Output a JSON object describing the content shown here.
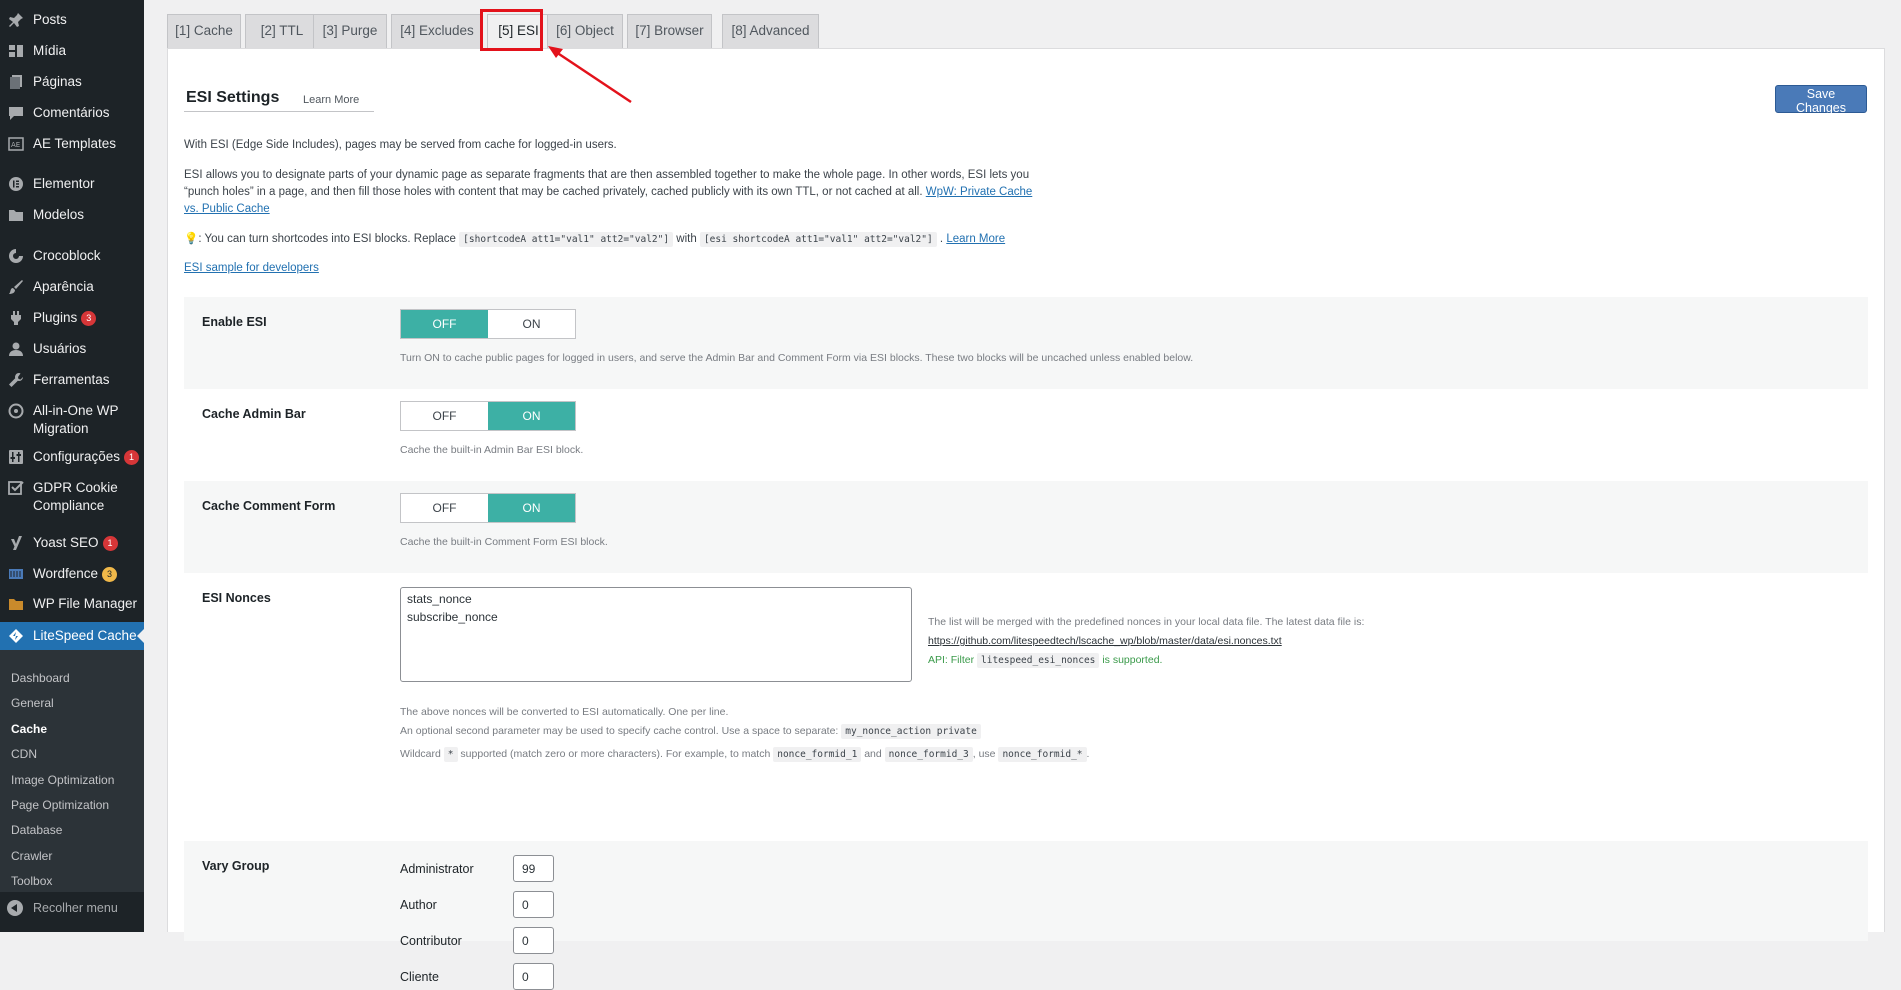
{
  "sidebar": {
    "items": [
      {
        "label": "Posts",
        "icon": "pin-icon"
      },
      {
        "label": "Mídia",
        "icon": "media-icon"
      },
      {
        "label": "Páginas",
        "icon": "pages-icon"
      },
      {
        "label": "Comentários",
        "icon": "comment-icon"
      },
      {
        "label": "AE Templates",
        "icon": "ae-templates-icon"
      },
      {
        "label": "Elementor",
        "icon": "elementor-icon"
      },
      {
        "label": "Modelos",
        "icon": "folder-icon"
      },
      {
        "label": "Crocoblock",
        "icon": "crocoblock-icon"
      },
      {
        "label": "Aparência",
        "icon": "brush-icon"
      },
      {
        "label": "Plugins",
        "icon": "plugin-icon",
        "badge": "3"
      },
      {
        "label": "Usuários",
        "icon": "user-icon"
      },
      {
        "label": "Ferramentas",
        "icon": "wrench-icon"
      },
      {
        "label": "All-in-One WP Migration",
        "icon": "migration-icon"
      },
      {
        "label": "Configurações",
        "icon": "settings-icon",
        "badge": "1"
      },
      {
        "label": "GDPR Cookie Compliance",
        "icon": "checkbox-icon"
      },
      {
        "label": "Yoast SEO",
        "icon": "yoast-icon",
        "badge": "1"
      },
      {
        "label": "Wordfence",
        "icon": "wordfence-icon",
        "badge": "3"
      },
      {
        "label": "WP File Manager",
        "icon": "file-manager-icon"
      }
    ],
    "current": {
      "label": "LiteSpeed Cache",
      "icon": "litespeed-icon"
    },
    "submenu": [
      "Dashboard",
      "General",
      "Cache",
      "CDN",
      "Image Optimization",
      "Page Optimization",
      "Database",
      "Crawler",
      "Toolbox"
    ],
    "submenu_current": "Cache",
    "collapse_label": "Recolher menu"
  },
  "tabs": [
    {
      "label": "[1] Cache"
    },
    {
      "label": "[2] TTL"
    },
    {
      "label": "[3] Purge"
    },
    {
      "label": "[4] Excludes"
    },
    {
      "label": "[5] ESI",
      "active": true
    },
    {
      "label": "[6] Object"
    },
    {
      "label": "[7] Browser"
    },
    {
      "label": "[8] Advanced"
    }
  ],
  "header": {
    "title": "ESI Settings",
    "learn_more": "Learn More",
    "save_label": "Save Changes"
  },
  "intro": {
    "p1": "With ESI (Edge Side Includes), pages may be served from cache for logged-in users.",
    "p2_line1": "ESI allows you to designate parts of your dynamic page as separate fragments that are then assembled together to make the whole page. In other words, ESI lets you",
    "p2_line2_text": "“punch holes” in a page, and then fill those holes with content that may be cached privately, cached publicly with its own TTL, or not cached at all.",
    "p2_link_a": "WpW: Private Cache",
    "p2_link_b": "vs. Public Cache",
    "tip_icon": "💡",
    "tip_text": ": You can turn shortcodes into ESI blocks. Replace",
    "tip_code1": "[shortcodeA att1=\"val1\" att2=\"val2\"]",
    "tip_with": "with",
    "tip_code2": "[esi shortcodeA att1=\"val1\" att2=\"val2\"]",
    "tip_learn": "Learn More",
    "sample_link": "ESI sample for developers"
  },
  "settings": {
    "enable_esi": {
      "label": "Enable ESI",
      "off": "OFF",
      "on": "ON",
      "value": "off",
      "desc": "Turn ON to cache public pages for logged in users, and serve the Admin Bar and Comment Form via ESI blocks. These two blocks will be uncached unless enabled below."
    },
    "cache_admin_bar": {
      "label": "Cache Admin Bar",
      "off": "OFF",
      "on": "ON",
      "value": "on",
      "desc": "Cache the built-in Admin Bar ESI block."
    },
    "cache_comment_form": {
      "label": "Cache Comment Form",
      "off": "OFF",
      "on": "ON",
      "value": "on",
      "desc": "Cache the built-in Comment Form ESI block."
    },
    "esi_nonces": {
      "label": "ESI Nonces",
      "value": "stats_nonce\nsubscribe_nonce",
      "note1": "The list will be merged with the predefined nonces in your local data file. The latest data file is:",
      "note_link": "https://github.com/litespeedtech/lscache_wp/blob/master/data/esi.nonces.txt",
      "api_text": "API: Filter",
      "api_code": "litespeed_esi_nonces",
      "api_tail": "is supported.",
      "desc1": "The above nonces will be converted to ESI automatically. One per line.",
      "desc2": "An optional second parameter may be used to specify cache control. Use a space to separate:",
      "desc2_code": "my_nonce_action private",
      "desc3_a": "Wildcard",
      "desc3_code1": "*",
      "desc3_b": "supported (match zero or more characters). For example, to match",
      "desc3_code2": "nonce_formid_1",
      "desc3_and": "and",
      "desc3_code3": "nonce_formid_3",
      "desc3_use": ", use",
      "desc3_code4": "nonce_formid_*",
      "desc3_end": "."
    },
    "vary_group": {
      "label": "Vary Group",
      "roles": [
        {
          "role": "Administrator",
          "value": "99"
        },
        {
          "role": "Author",
          "value": "0"
        },
        {
          "role": "Contributor",
          "value": "0"
        },
        {
          "role": "Cliente",
          "value": "0"
        }
      ]
    }
  },
  "colors": {
    "toggle_on": "#3db0a5",
    "highlight": "#e3121b",
    "wp_blue": "#2271b1"
  }
}
